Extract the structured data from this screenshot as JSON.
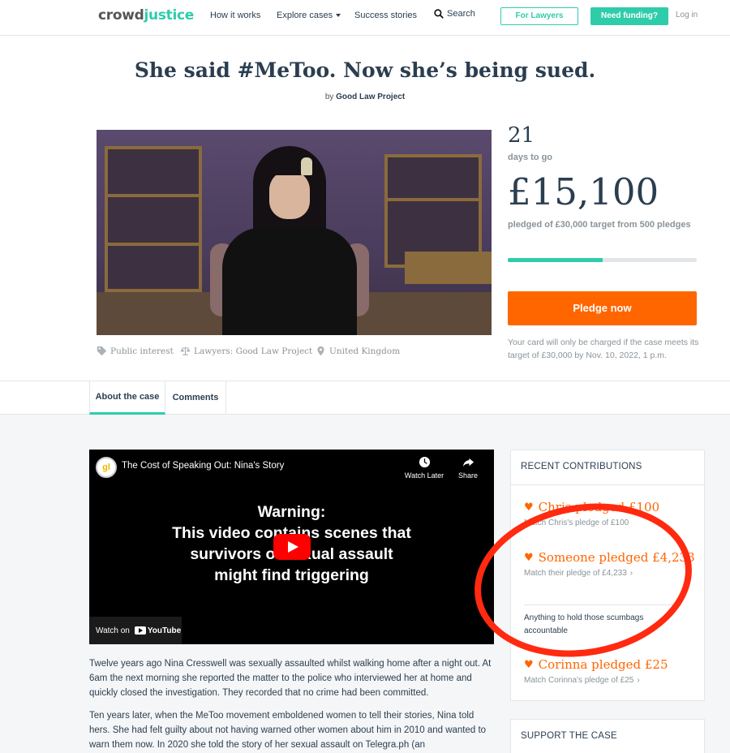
{
  "nav": {
    "logo_crowd": "crowd",
    "logo_justice": "justice",
    "how_it_works": "How it works",
    "explore_cases": "Explore cases",
    "success_stories": "Success stories",
    "search": "Search",
    "for_lawyers": "For Lawyers",
    "need_funding": "Need funding?",
    "login": "Log in"
  },
  "case": {
    "title": "She said #MeToo. Now she’s being sued.",
    "by_prefix": "by",
    "by_name": "Good Law Project",
    "days_num": "21",
    "days_label": "days to go",
    "amount": "£15,100",
    "target_text": "pledged of £30,000 target from 500 pledges",
    "progress_fraction": 0.5033,
    "pledge_button": "Pledge now",
    "charge_note": "Your card will only be charged if the case meets its target of £30,000 by Nov. 10, 2022, 1 p.m.",
    "meta": {
      "category": "Public interest",
      "lawyers": "Lawyers: Good Law Project",
      "location": "United Kingdom"
    }
  },
  "tabs": {
    "about": "About the case",
    "comments": "Comments"
  },
  "video": {
    "title": "The Cost of Speaking Out: Nina's Story",
    "channel_initials": "gl",
    "watch_later": "Watch Later",
    "share": "Share",
    "warning_l1": "Warning:",
    "warning_l2": "This video contains scenes that",
    "warning_l3": "survivors of sexual assault",
    "warning_l4": "might find triggering",
    "watch_on": "Watch on",
    "youtube": "YouTube"
  },
  "story": {
    "p1": "Twelve years ago Nina Cresswell was sexually assaulted whilst walking home after a night out. At 6am the next morning she reported the matter to the police who interviewed her at home and quickly closed the investigation. They recorded that no crime had been committed.",
    "p2": "Ten years later, when the MeToo movement emboldened women to tell their stories, Nina told hers. She had felt guilty about not having warned other women about him in 2010 and wanted to warn them now. In 2020 she told the story of her sexual assault on Telegra.ph (an"
  },
  "sidebar": {
    "recent_heading": "RECENT CONTRIBUTIONS",
    "contributions": [
      {
        "title": "Chris pledged £100",
        "match": "Match Chris's pledge of £100"
      },
      {
        "title": "Someone pledged £4,233",
        "match": "Match their pledge of £4,233",
        "message": "Anything to hold those scumbags accountable"
      },
      {
        "title": "Corinna pledged £25",
        "match": "Match Corinna's pledge of £25"
      }
    ],
    "support_heading": "SUPPORT THE CASE"
  },
  "colors": {
    "accent": "#2fccaa",
    "pledge": "#ff6600",
    "annotation": "#ff2a10"
  }
}
